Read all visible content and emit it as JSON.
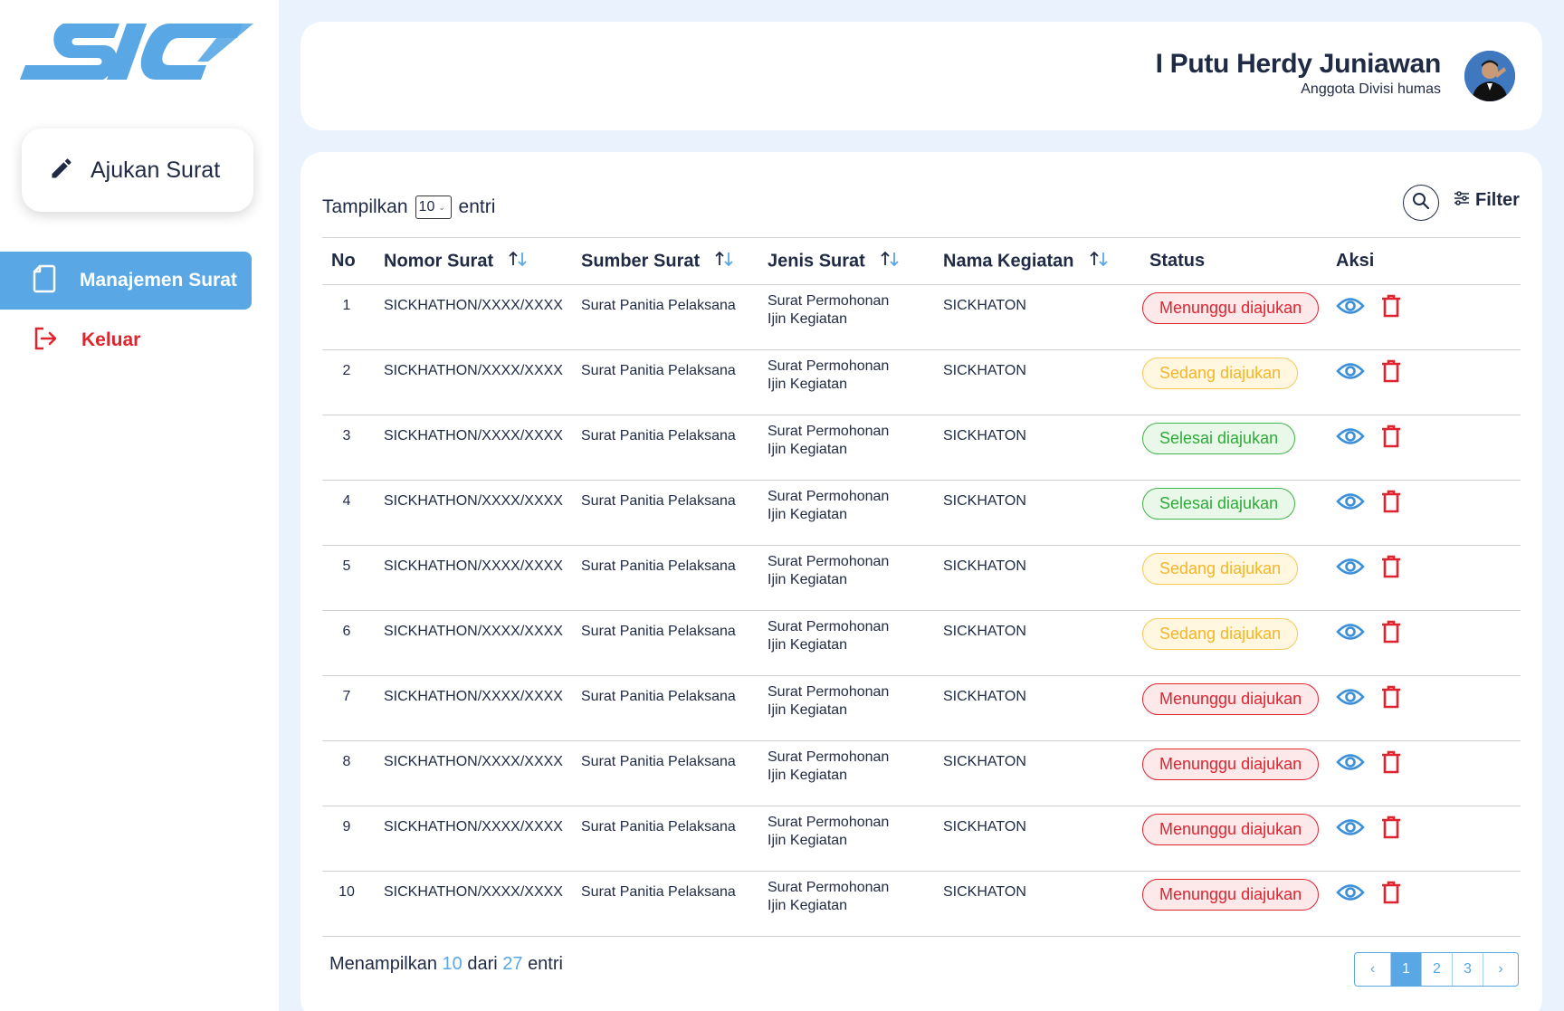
{
  "brand": {
    "logo_text": "SIC",
    "accent": "#5aa7e6"
  },
  "sidebar": {
    "compose_label": "Ajukan Surat",
    "items": [
      {
        "label": "Manajemen Surat",
        "icon": "document-icon",
        "active": true
      },
      {
        "label": "Keluar",
        "icon": "logout-icon",
        "active": false
      }
    ]
  },
  "header": {
    "user_name": "I Putu Herdy Juniawan",
    "user_role": "Anggota Divisi humas"
  },
  "toolbar": {
    "show_label": "Tampilkan",
    "page_size": "10",
    "entries_label": "entri",
    "filter_label": "Filter"
  },
  "table": {
    "columns": [
      "No",
      "Nomor Surat",
      "Sumber Surat",
      "Jenis Surat",
      "Nama Kegiatan",
      "Status",
      "Aksi"
    ],
    "rows": [
      {
        "no": "1",
        "nomor": "SICKHATHON/XXXX/XXXX",
        "sumber": "Surat Panitia Pelaksana",
        "jenis": "Surat Permohonan Ijin Kegiatan",
        "kegiatan": "SICKHATON",
        "status": "Menunggu diajukan",
        "status_type": "red"
      },
      {
        "no": "2",
        "nomor": "SICKHATHON/XXXX/XXXX",
        "sumber": "Surat Panitia Pelaksana",
        "jenis": "Surat Permohonan Ijin Kegiatan",
        "kegiatan": "SICKHATON",
        "status": "Sedang diajukan",
        "status_type": "yellow"
      },
      {
        "no": "3",
        "nomor": "SICKHATHON/XXXX/XXXX",
        "sumber": "Surat Panitia Pelaksana",
        "jenis": "Surat Permohonan Ijin Kegiatan",
        "kegiatan": "SICKHATON",
        "status": "Selesai diajukan",
        "status_type": "green"
      },
      {
        "no": "4",
        "nomor": "SICKHATHON/XXXX/XXXX",
        "sumber": "Surat Panitia Pelaksana",
        "jenis": "Surat Permohonan Ijin Kegiatan",
        "kegiatan": "SICKHATON",
        "status": "Selesai diajukan",
        "status_type": "green"
      },
      {
        "no": "5",
        "nomor": "SICKHATHON/XXXX/XXXX",
        "sumber": "Surat Panitia Pelaksana",
        "jenis": "Surat Permohonan Ijin Kegiatan",
        "kegiatan": "SICKHATON",
        "status": "Sedang diajukan",
        "status_type": "yellow"
      },
      {
        "no": "6",
        "nomor": "SICKHATHON/XXXX/XXXX",
        "sumber": "Surat Panitia Pelaksana",
        "jenis": "Surat Permohonan Ijin Kegiatan",
        "kegiatan": "SICKHATON",
        "status": "Sedang diajukan",
        "status_type": "yellow"
      },
      {
        "no": "7",
        "nomor": "SICKHATHON/XXXX/XXXX",
        "sumber": "Surat Panitia Pelaksana",
        "jenis": "Surat Permohonan Ijin Kegiatan",
        "kegiatan": "SICKHATON",
        "status": "Menunggu diajukan",
        "status_type": "red"
      },
      {
        "no": "8",
        "nomor": "SICKHATHON/XXXX/XXXX",
        "sumber": "Surat Panitia Pelaksana",
        "jenis": "Surat Permohonan Ijin Kegiatan",
        "kegiatan": "SICKHATON",
        "status": "Menunggu diajukan",
        "status_type": "red"
      },
      {
        "no": "9",
        "nomor": "SICKHATHON/XXXX/XXXX",
        "sumber": "Surat Panitia Pelaksana",
        "jenis": "Surat Permohonan Ijin Kegiatan",
        "kegiatan": "SICKHATON",
        "status": "Menunggu diajukan",
        "status_type": "red"
      },
      {
        "no": "10",
        "nomor": "SICKHATHON/XXXX/XXXX",
        "sumber": "Surat Panitia Pelaksana",
        "jenis": "Surat Permohonan Ijin Kegiatan",
        "kegiatan": "SICKHATON",
        "status": "Menunggu diajukan",
        "status_type": "red"
      }
    ]
  },
  "footer": {
    "prefix": "Menampilkan",
    "shown": "10",
    "middle": "dari",
    "total": "27",
    "suffix": "entri"
  },
  "pagination": {
    "prev": "‹",
    "pages": [
      "1",
      "2",
      "3"
    ],
    "current": "1",
    "next": "›"
  },
  "colors": {
    "status_red": "#e0242e",
    "status_yellow": "#f4b62a",
    "status_green": "#2eaa3a",
    "eye_icon": "#3b8fd8"
  }
}
